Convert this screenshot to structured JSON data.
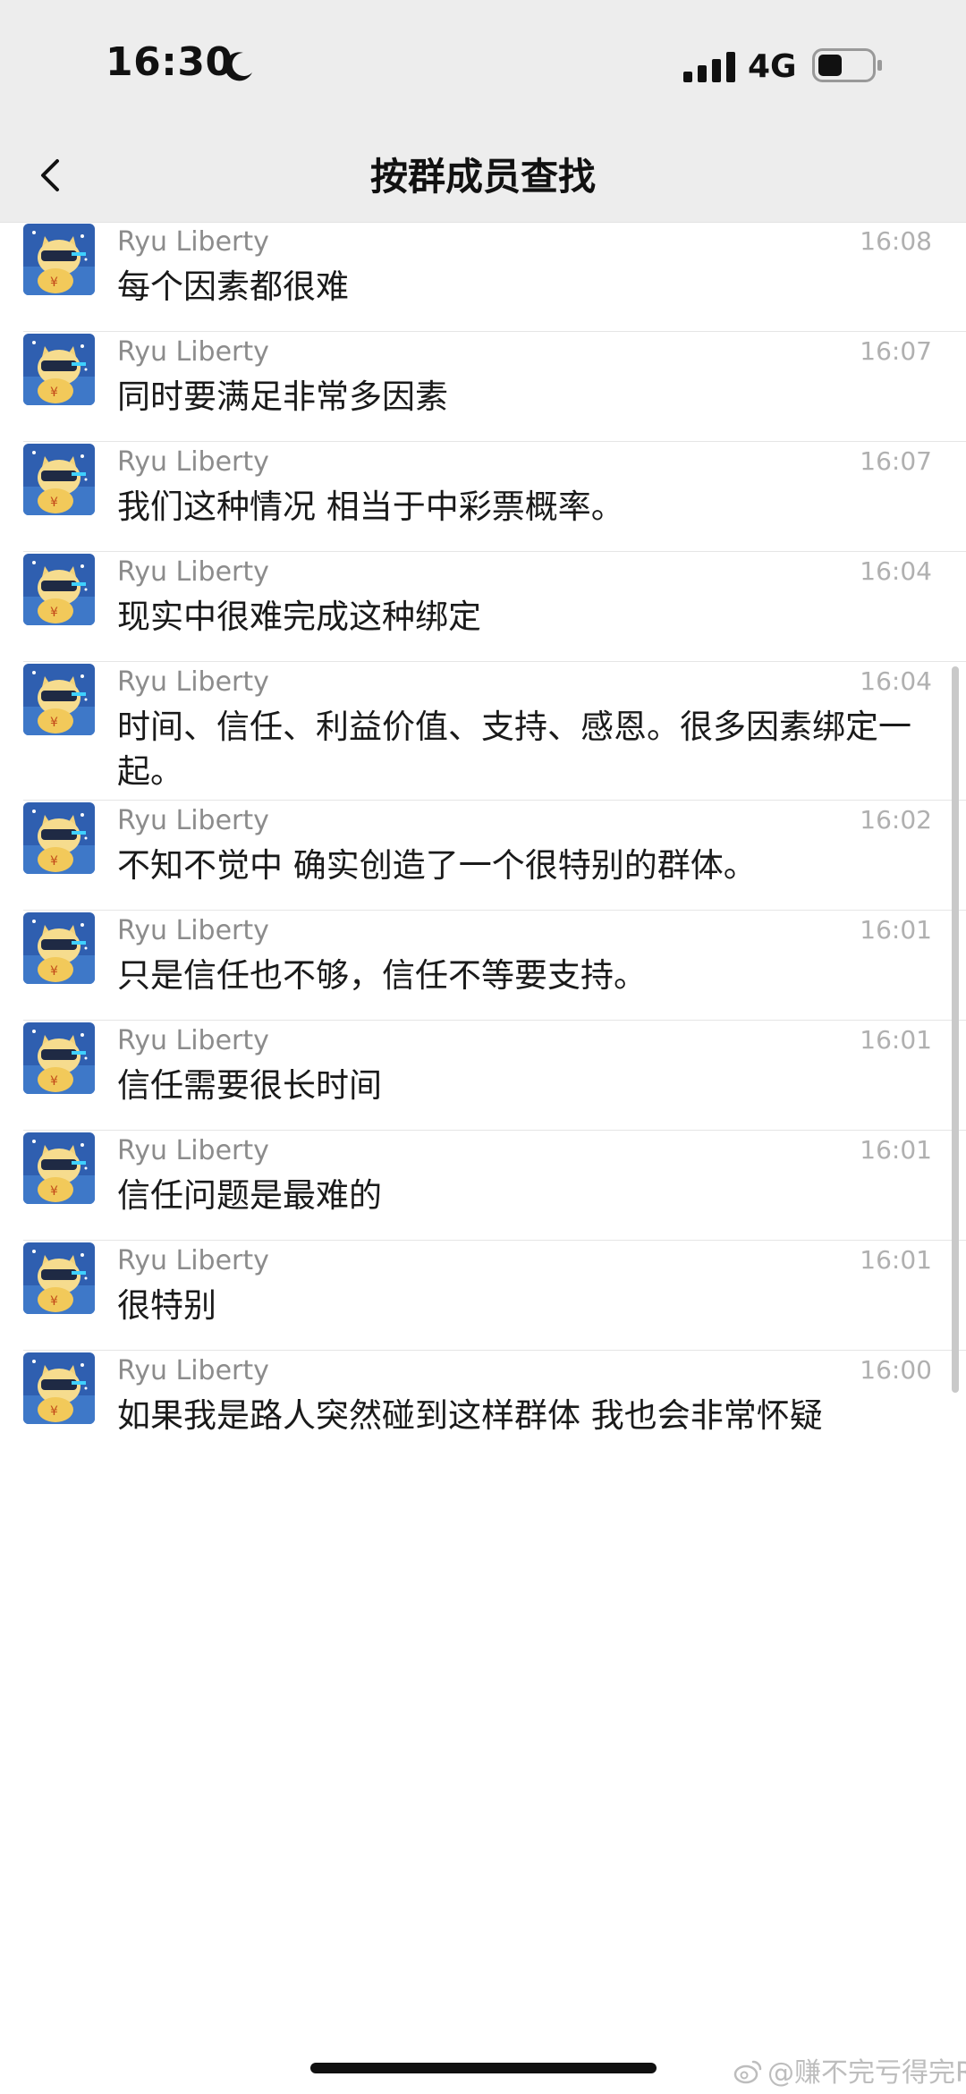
{
  "status_bar": {
    "time": "16:30",
    "network": "4G"
  },
  "header": {
    "title": "按群成员查找"
  },
  "messages": [
    {
      "sender": "Ryu Liberty",
      "time": "16:08",
      "text": "每个因素都很难"
    },
    {
      "sender": "Ryu Liberty",
      "time": "16:07",
      "text": "同时要满足非常多因素"
    },
    {
      "sender": "Ryu Liberty",
      "time": "16:07",
      "text": "我们这种情况 相当于中彩票概率。"
    },
    {
      "sender": "Ryu Liberty",
      "time": "16:04",
      "text": "现实中很难完成这种绑定"
    },
    {
      "sender": "Ryu Liberty",
      "time": "16:04",
      "text": "时间、信任、利益价值、支持、感恩。很多因素绑定一起。"
    },
    {
      "sender": "Ryu Liberty",
      "time": "16:02",
      "text": "不知不觉中 确实创造了一个很特别的群体。"
    },
    {
      "sender": "Ryu Liberty",
      "time": "16:01",
      "text": "只是信任也不够，信任不等要支持。"
    },
    {
      "sender": "Ryu Liberty",
      "time": "16:01",
      "text": "信任需要很长时间"
    },
    {
      "sender": "Ryu Liberty",
      "time": "16:01",
      "text": "信任问题是最难的"
    },
    {
      "sender": "Ryu Liberty",
      "time": "16:01",
      "text": "很特别"
    },
    {
      "sender": "Ryu Liberty",
      "time": "16:00",
      "text": "如果我是路人突然碰到这样群体 我也会非常怀疑"
    }
  ],
  "watermark": {
    "text": "@赚不完亏得完R"
  },
  "icons": {
    "back": "chevron-left-icon",
    "moon": "moon-icon",
    "signal": "signal-icon",
    "battery": "battery-icon",
    "avatar": "avatar-cat-image"
  },
  "colors": {
    "topbar_bg": "#ededed",
    "sender": "#8c8c8c",
    "time": "#b0b0b0",
    "message": "#1a1a1a"
  }
}
